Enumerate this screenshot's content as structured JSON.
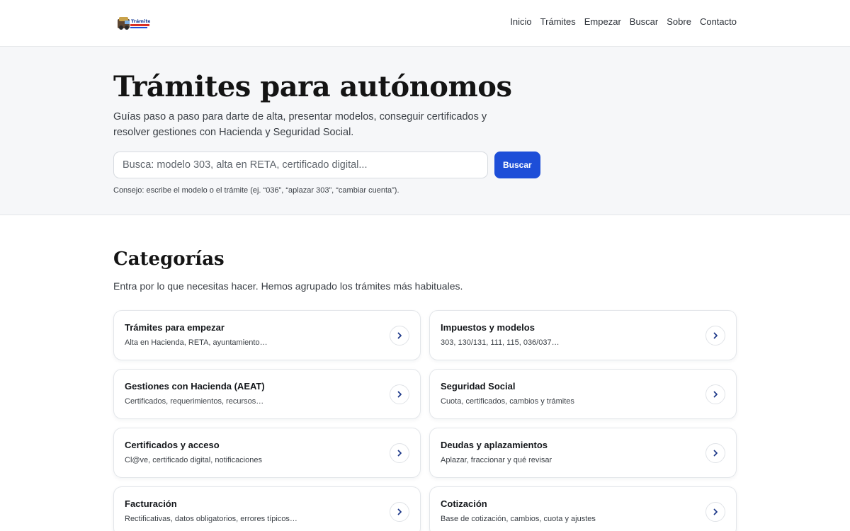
{
  "header": {
    "logo_icon": "tramites-logo",
    "logo_text": "Trámites",
    "nav": [
      {
        "label": "Inicio"
      },
      {
        "label": "Trámites"
      },
      {
        "label": "Empezar"
      },
      {
        "label": "Buscar"
      },
      {
        "label": "Sobre"
      },
      {
        "label": "Contacto"
      }
    ]
  },
  "hero": {
    "title": "Trámites para autónomos",
    "subtitle": "Guías paso a paso para darte de alta, presentar modelos, conseguir certificados y resolver gestiones con Hacienda y Seguridad Social.",
    "search_placeholder": "Busca: modelo 303, alta en RETA, certificado digital...",
    "search_value": "",
    "search_button": "Buscar",
    "hint": "Consejo: escribe el modelo o el trámite (ej. “036”, “aplazar 303”, “cambiar cuenta”)."
  },
  "categories": {
    "title": "Categorías",
    "subtitle": "Entra por lo que necesitas hacer. Hemos agrupado los trámites más habituales.",
    "chevron_icon": "chevron-right-icon",
    "accent_color": "#1d4ed8",
    "items": [
      {
        "title": "Trámites para empezar",
        "desc": "Alta en Hacienda, RETA, ayuntamiento…"
      },
      {
        "title": "Impuestos y modelos",
        "desc": "303, 130/131, 111, 115, 036/037…"
      },
      {
        "title": "Gestiones con Hacienda (AEAT)",
        "desc": "Certificados, requerimientos, recursos…"
      },
      {
        "title": "Seguridad Social",
        "desc": "Cuota, certificados, cambios y trámites"
      },
      {
        "title": "Certificados y acceso",
        "desc": "Cl@ve, certificado digital, notificaciones"
      },
      {
        "title": "Deudas y aplazamientos",
        "desc": "Aplazar, fraccionar y qué revisar"
      },
      {
        "title": "Facturación",
        "desc": "Rectificativas, datos obligatorios, errores típicos…"
      },
      {
        "title": "Cotización",
        "desc": "Base de cotización, cambios, cuota y ajustes"
      }
    ]
  }
}
